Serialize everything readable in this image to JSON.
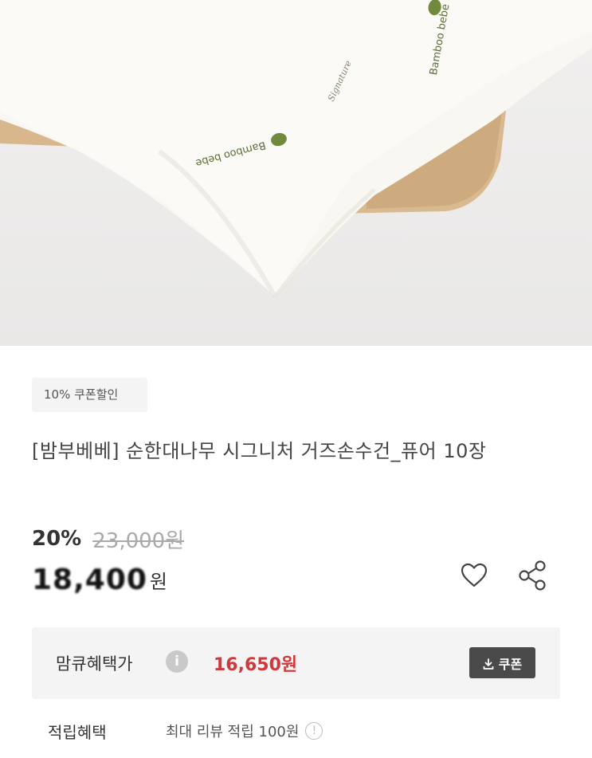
{
  "product_image": {
    "towel_print_1": "Bamboo bebe",
    "towel_print_2": "Bamboo bebe",
    "towel_signature": "Signature"
  },
  "badge": "10% 쿠폰할인",
  "title": "[밤부베베] 순한대나무 시그니처 거즈손수건_퓨어 10장",
  "pricing": {
    "discount_pct": "20%",
    "original_price": "23,000원",
    "sale_price": "18,400",
    "sale_unit": "원"
  },
  "benefit": {
    "label": "맘큐혜택가",
    "info_glyph": "i",
    "price": "16,650원",
    "coupon_label": "쿠폰"
  },
  "points": {
    "label": "적립혜택",
    "value": "최대 리뷰 적립 100원",
    "info_glyph": "!"
  },
  "colors": {
    "accent_red": "#d0393c",
    "coupon_button": "#4a4a4a",
    "logo_green": "#6f8a3c"
  }
}
